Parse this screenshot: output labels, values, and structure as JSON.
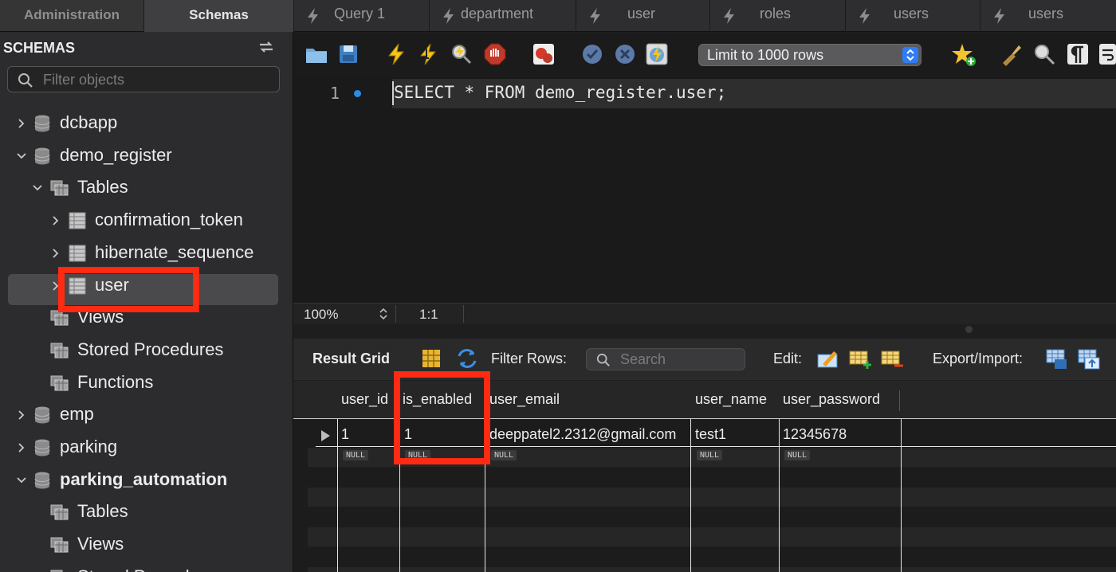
{
  "left_tabs": [
    "Administration",
    "Schemas"
  ],
  "sidebar": {
    "header": "SCHEMAS",
    "filter_placeholder": "Filter objects",
    "items": [
      {
        "label": "dcbapp",
        "expanded": false,
        "level": 0
      },
      {
        "label": "demo_register",
        "expanded": true,
        "level": 0
      },
      {
        "label": "Tables",
        "expanded": true,
        "level": 1
      },
      {
        "label": "confirmation_token",
        "expanded": false,
        "level": 2
      },
      {
        "label": "hibernate_sequence",
        "expanded": false,
        "level": 2
      },
      {
        "label": "user",
        "expanded": false,
        "level": 2,
        "selected": true
      },
      {
        "label": "Views",
        "level": 1
      },
      {
        "label": "Stored Procedures",
        "level": 1
      },
      {
        "label": "Functions",
        "level": 1
      },
      {
        "label": "emp",
        "expanded": false,
        "level": 0
      },
      {
        "label": "parking",
        "expanded": false,
        "level": 0
      },
      {
        "label": "parking_automation",
        "expanded": true,
        "level": 0,
        "bold": true
      },
      {
        "label": "Tables",
        "level": 1
      },
      {
        "label": "Views",
        "level": 1
      },
      {
        "label": "Stored Procedures",
        "level": 1
      }
    ]
  },
  "query_tabs": [
    "Query 1",
    "department",
    "user",
    "roles",
    "users",
    "users"
  ],
  "toolbar": {
    "limit_select": "Limit to 1000 rows"
  },
  "editor": {
    "line_number": "1",
    "sql": "SELECT * FROM demo_register.user;"
  },
  "status": {
    "zoom": "100%",
    "cursor": "1:1"
  },
  "results": {
    "title": "Result Grid",
    "filter_label": "Filter Rows:",
    "search_placeholder": "Search",
    "edit_label": "Edit:",
    "export_label": "Export/Import:",
    "columns": [
      "user_id",
      "is_enabled",
      "user_email",
      "user_name",
      "user_password"
    ],
    "rows": [
      [
        "1",
        "1",
        "deeppatel2.2312@gmail.com",
        "test1",
        "12345678"
      ]
    ],
    "null_label": "NULL"
  },
  "colors": {
    "highlight": "#ff2a12",
    "accent": "#2f7cf6",
    "background": "#1e1e1e"
  }
}
